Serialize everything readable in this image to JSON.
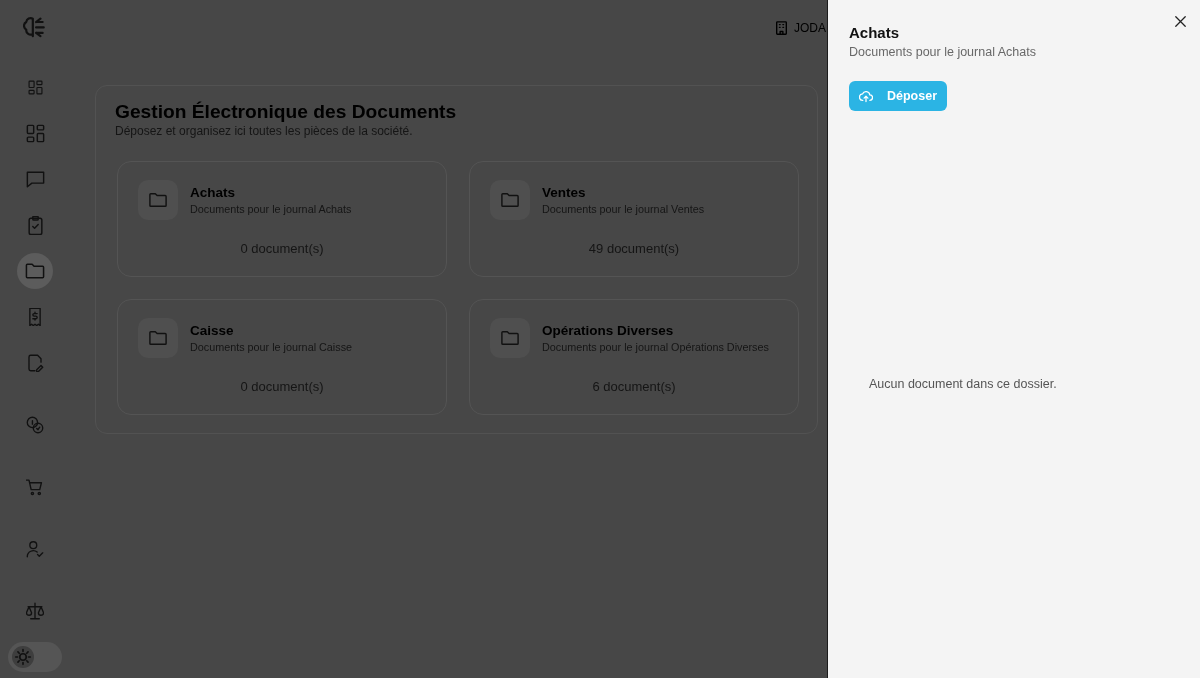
{
  "sidebar": {
    "groups": [
      {
        "items": [
          {
            "selected": false
          },
          {
            "selected": false
          },
          {
            "selected": false
          },
          {
            "selected": false
          },
          {
            "selected": true
          },
          {
            "selected": false
          },
          {
            "selected": false
          }
        ]
      },
      {
        "items": [
          {
            "selected": false
          }
        ]
      },
      {
        "items": [
          {
            "selected": false
          }
        ]
      },
      {
        "items": [
          {
            "selected": false
          }
        ]
      },
      {
        "items": [
          {
            "selected": false
          }
        ]
      }
    ]
  },
  "theme_toggle": {
    "on": false
  },
  "header": {
    "company": "JODA"
  },
  "page": {
    "title": "Gestion Électronique des Documents",
    "subtitle": "Déposez et organisez ici toutes les pièces de la société."
  },
  "folders": [
    {
      "name": "Achats",
      "description": "Documents pour le journal Achats",
      "count": "0 document(s)"
    },
    {
      "name": "Ventes",
      "description": "Documents pour le journal Ventes",
      "count": "49 document(s)"
    },
    {
      "name": "Caisse",
      "description": "Documents pour le journal Caisse",
      "count": "0 document(s)"
    },
    {
      "name": "Opérations Diverses",
      "description": "Documents pour le journal Opérations Diverses",
      "count": "6 document(s)"
    }
  ],
  "drawer": {
    "title": "Achats",
    "subtitle": "Documents pour le journal Achats",
    "upload_button": "Déposer",
    "empty_message": "Aucun document dans ce dossier."
  }
}
